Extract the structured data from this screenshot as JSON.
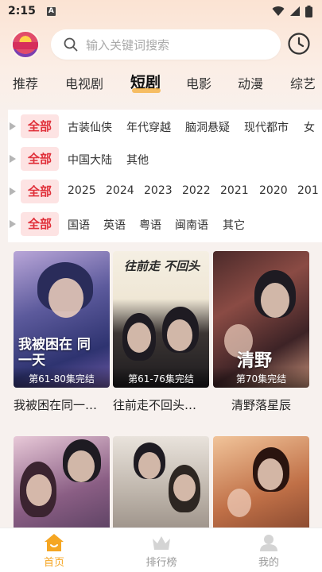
{
  "status": {
    "time": "2:15",
    "notif_letter": "A"
  },
  "search": {
    "placeholder": "输入关键词搜索"
  },
  "tabs": [
    {
      "label": "推荐"
    },
    {
      "label": "电视剧"
    },
    {
      "label": "短剧"
    },
    {
      "label": "电影"
    },
    {
      "label": "动漫"
    },
    {
      "label": "综艺"
    }
  ],
  "active_tab": "短剧",
  "filters": {
    "all_label": "全部",
    "genre": [
      "古装仙侠",
      "年代穿越",
      "脑洞悬疑",
      "现代都市",
      "女"
    ],
    "region": [
      "中国大陆",
      "其他"
    ],
    "year": [
      "2025",
      "2024",
      "2023",
      "2022",
      "2021",
      "2020",
      "201"
    ],
    "language": [
      "国语",
      "英语",
      "粤语",
      "闽南语",
      "其它"
    ]
  },
  "cards": [
    {
      "title": "我被困在同一…",
      "badge": "第61-80集完结",
      "poster_text": "我被困在 同一天"
    },
    {
      "title": "往前走不回头…",
      "badge": "第61-76集完结",
      "poster_text": "往前走 不回头"
    },
    {
      "title": "清野落星辰",
      "badge": "第70集完结",
      "poster_text": "清野"
    },
    {
      "title": "",
      "badge": "",
      "poster_text": ""
    },
    {
      "title": "",
      "badge": "",
      "poster_text": ""
    },
    {
      "title": "",
      "badge": "",
      "poster_text": ""
    }
  ],
  "nav": [
    {
      "label": "首页",
      "icon": "home-icon",
      "active": true
    },
    {
      "label": "排行榜",
      "icon": "crown-icon",
      "active": false
    },
    {
      "label": "我的",
      "icon": "user-icon",
      "active": false
    }
  ],
  "colors": {
    "accent": "#f5a623",
    "all_chip_text": "#e0303a",
    "all_chip_bg": "#fde3e3"
  }
}
